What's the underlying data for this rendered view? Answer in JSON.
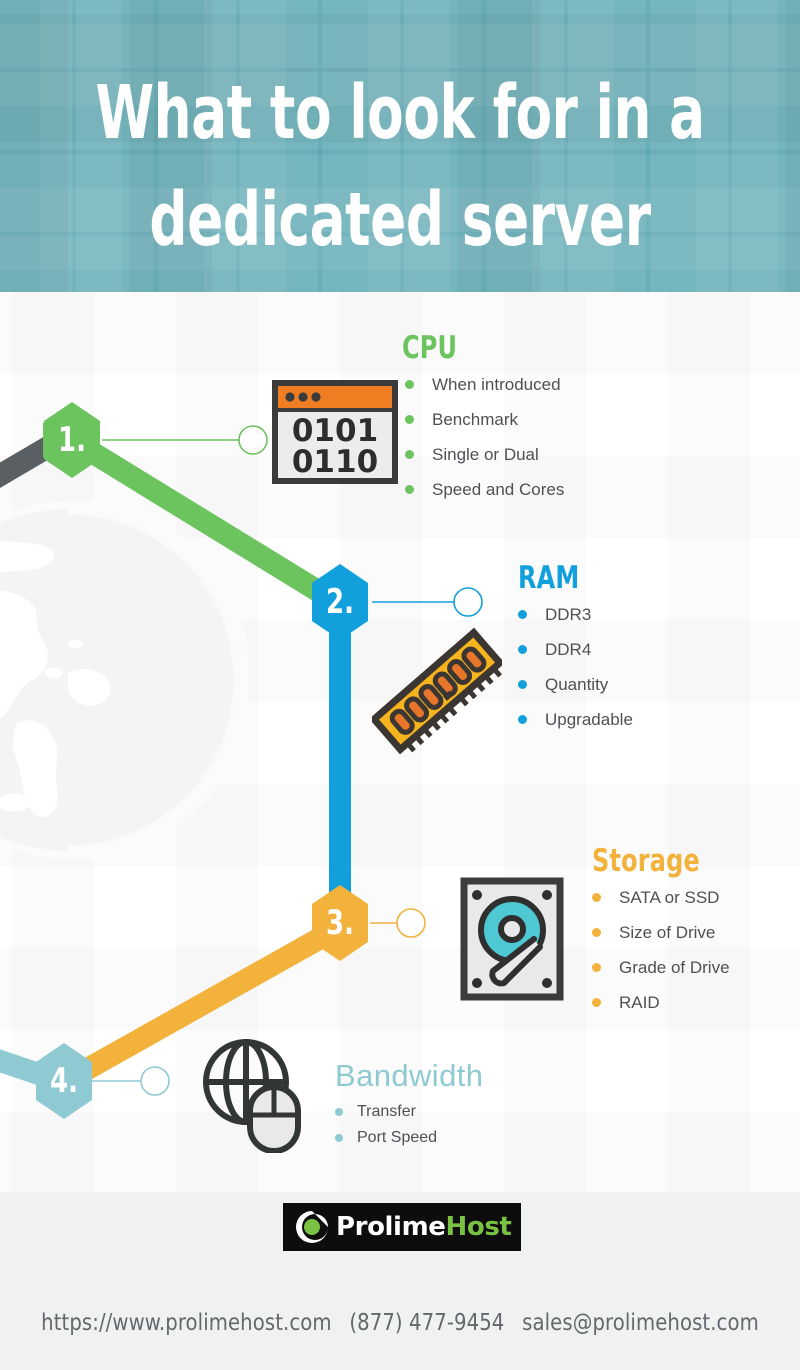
{
  "header": {
    "title": "What to look for in a\ndedicated server",
    "bg_color": "#5fa9b3"
  },
  "sections": [
    {
      "step": "1.",
      "title": "CPU",
      "color": "#6cc45e",
      "icon": "binary-window-icon",
      "items": [
        "When introduced",
        "Benchmark",
        "Single or Dual",
        "Speed and Cores"
      ]
    },
    {
      "step": "2.",
      "title": "RAM",
      "color": "#12a0dd",
      "icon": "memory-stick-icon",
      "items": [
        "DDR3",
        "DDR4",
        "Quantity",
        "Upgradable"
      ]
    },
    {
      "step": "3.",
      "title": "Storage",
      "color": "#f2b23c",
      "icon": "hard-drive-icon",
      "items": [
        "SATA or SSD",
        "Size of Drive",
        "Grade of Drive",
        "RAID"
      ]
    },
    {
      "step": "4.",
      "title": "Bandwidth",
      "color": "#8fc9d2",
      "icon": "globe-mouse-icon",
      "items": [
        "Transfer",
        "Port Speed"
      ]
    }
  ],
  "icons": {
    "cpu_binary_line1": "0101",
    "cpu_binary_line2": "0110"
  },
  "footer": {
    "logo_part1": "Prolime",
    "logo_part2": "Host",
    "logo_mark": "prolimehost-swirl-icon",
    "website": "https://www.prolimehost.com",
    "phone": "(877) 477-9454",
    "email": "sales@prolimehost.com",
    "bg_color": "#f0f1f1"
  }
}
